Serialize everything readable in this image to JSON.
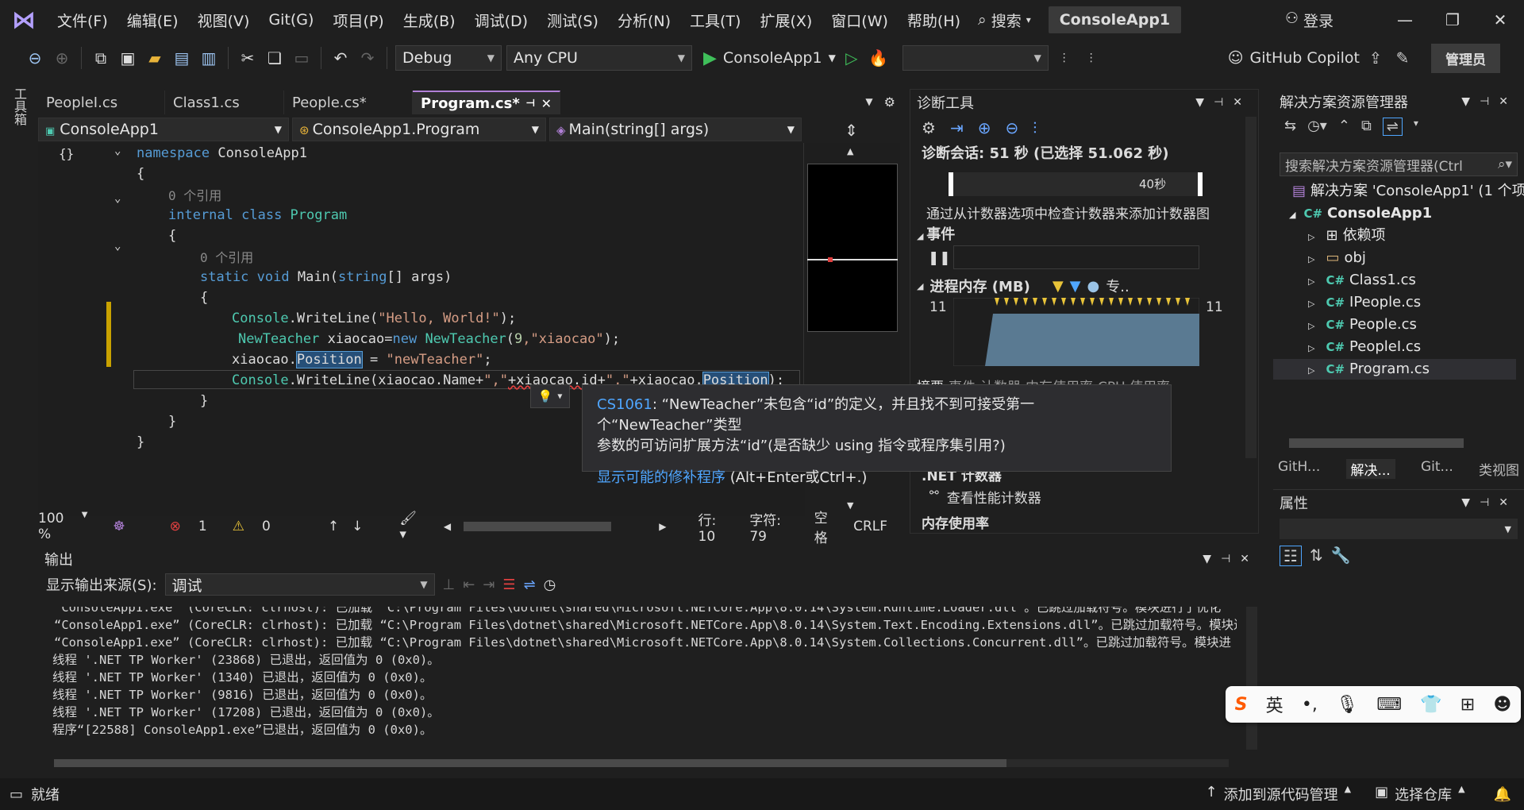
{
  "menubar": {
    "items": [
      "文件(F)",
      "编辑(E)",
      "视图(V)",
      "Git(G)",
      "项目(P)",
      "生成(B)",
      "调试(D)",
      "测试(S)",
      "分析(N)",
      "工具(T)",
      "扩展(X)",
      "窗口(W)",
      "帮助(H)"
    ],
    "search": "搜索",
    "project_title": "ConsoleApp1",
    "login": "登录"
  },
  "toolbar": {
    "config": "Debug",
    "platform": "Any CPU",
    "run_target": "ConsoleApp1",
    "copilot": "GitHub Copilot",
    "admin": "管理员"
  },
  "leftstrip": {
    "label": "工具箱"
  },
  "editor": {
    "tabs": [
      "PeopleI.cs",
      "Class1.cs",
      "People.cs*",
      "Program.cs*"
    ],
    "nav": {
      "project": "ConsoleApp1",
      "class": "ConsoleApp1.Program",
      "member": "Main(string[] args)"
    },
    "lines": {
      "l1_kw": "namespace",
      "l1_id": " ConsoleApp1",
      "l2": "{",
      "l3_ref": "0 个引用",
      "l3_kw1": "internal",
      "l3_kw2": " class",
      "l3_ty": " Program",
      "l4": "{",
      "l5_ref": "0 个引用",
      "l5_kw1": "static",
      "l5_kw2": " void",
      "l5_id": " Main(",
      "l5_kw3": "string",
      "l5_id2": "[] args)",
      "l6": "{",
      "l7_ty": "Console",
      "l7_id": ".WriteLine(",
      "l7_st": "\"Hello, World!\"",
      "l7_end": ");",
      "l8_ty": "NewTeacher",
      "l8_id": " xiaocao=",
      "l8_kw": "new",
      "l8_ty2": " NewTeacher",
      "l8_id2": "(",
      "l8_nm": "9",
      "l8_st": ",\"xiaocao\"",
      "l8_end": ");",
      "l9_id": "xiaocao.",
      "l9_hl": "Position",
      "l9_id2": " = ",
      "l9_st": "\"newTeacher\"",
      "l9_end": ";",
      "l10_ty": "Console",
      "l10_id": ".WriteLine(xiaocao.Name+",
      "l10_st1": "\",\"",
      "l10_id2": "+xiaocao.id+",
      "l10_st2": "\",\"",
      "l10_id3": "+xiaocao.",
      "l10_hl": "Position",
      "l10_end": ");",
      "l11": "}",
      "l12": "}",
      "l13": "}"
    },
    "status": {
      "zoom": "100 %",
      "errors": "1",
      "warnings": "0",
      "line": "行: 10",
      "char": "字符: 79",
      "space": "空格",
      "eol": "CRLF"
    }
  },
  "tooltip": {
    "code": "CS1061",
    "msg1": ": “NewTeacher”未包含“id”的定义，并且找不到可接受第一个“NewTeacher”类型",
    "msg2": "参数的可访问扩展方法“id”(是否缺少 using 指令或程序集引用?)",
    "link": "显示可能的修补程序",
    "shortcut": " (Alt+Enter或Ctrl+.)"
  },
  "diag": {
    "title": "诊断工具",
    "session": "诊断会话: 51 秒 (已选择 51.062 秒)",
    "timemark": "40秒",
    "hint": "通过从计数器选项中检查计数器来添加计数器图",
    "events": "事件",
    "memory": "进程内存 (MB)",
    "legend2": "专..",
    "mem_left": "11",
    "mem_right": "11",
    "tabs": [
      "摘要",
      "事件",
      "计数器",
      "内存使用率",
      "CPU 使用率"
    ],
    "net_counters": ".NET 计数器",
    "view_counters": "查看性能计数器",
    "mem_usage": "内存使用率"
  },
  "solexp": {
    "title": "解决方案资源管理器",
    "search": "搜索解决方案资源管理器(Ctrl",
    "solution": "解决方案 'ConsoleApp1' (1 个项",
    "project": "ConsoleApp1",
    "items": [
      "依赖项",
      "obj",
      "Class1.cs",
      "IPeople.cs",
      "People.cs",
      "PeopleI.cs",
      "Program.cs"
    ],
    "bottom_tabs": [
      "GitH...",
      "解决...",
      "Git...",
      "类视图"
    ]
  },
  "props": {
    "title": "属性"
  },
  "output": {
    "title": "输出",
    "source_label": "显示输出来源(S):",
    "source": "调试",
    "lines": [
      "“ConsoleApp1.exe” (CoreCLR: clrhost): 已加载 “C:\\Program Files\\dotnet\\shared\\Microsoft.NETCore.App\\8.0.14\\System.Runtime.Loader.dll”。已跳过加载符号。模块进行了优化",
      "“ConsoleApp1.exe” (CoreCLR: clrhost): 已加载 “C:\\Program Files\\dotnet\\shared\\Microsoft.NETCore.App\\8.0.14\\System.Text.Encoding.Extensions.dll”。已跳过加载符号。模块进",
      "“ConsoleApp1.exe” (CoreCLR: clrhost): 已加载 “C:\\Program Files\\dotnet\\shared\\Microsoft.NETCore.App\\8.0.14\\System.Collections.Concurrent.dll”。已跳过加载符号。模块进",
      "线程 '.NET TP Worker' (23868) 已退出，返回值为 0 (0x0)。",
      "线程 '.NET TP Worker' (1340) 已退出，返回值为 0 (0x0)。",
      "线程 '.NET TP Worker' (9816) 已退出，返回值为 0 (0x0)。",
      "线程 '.NET TP Worker' (17208) 已退出，返回值为 0 (0x0)。",
      "程序“[22588] ConsoleApp1.exe”已退出，返回值为 0 (0x0)。"
    ]
  },
  "statusbar": {
    "ready": "就绪",
    "add_source": "添加到源代码管理",
    "select_repo": "选择仓库"
  },
  "ime": {
    "lang": "英"
  }
}
